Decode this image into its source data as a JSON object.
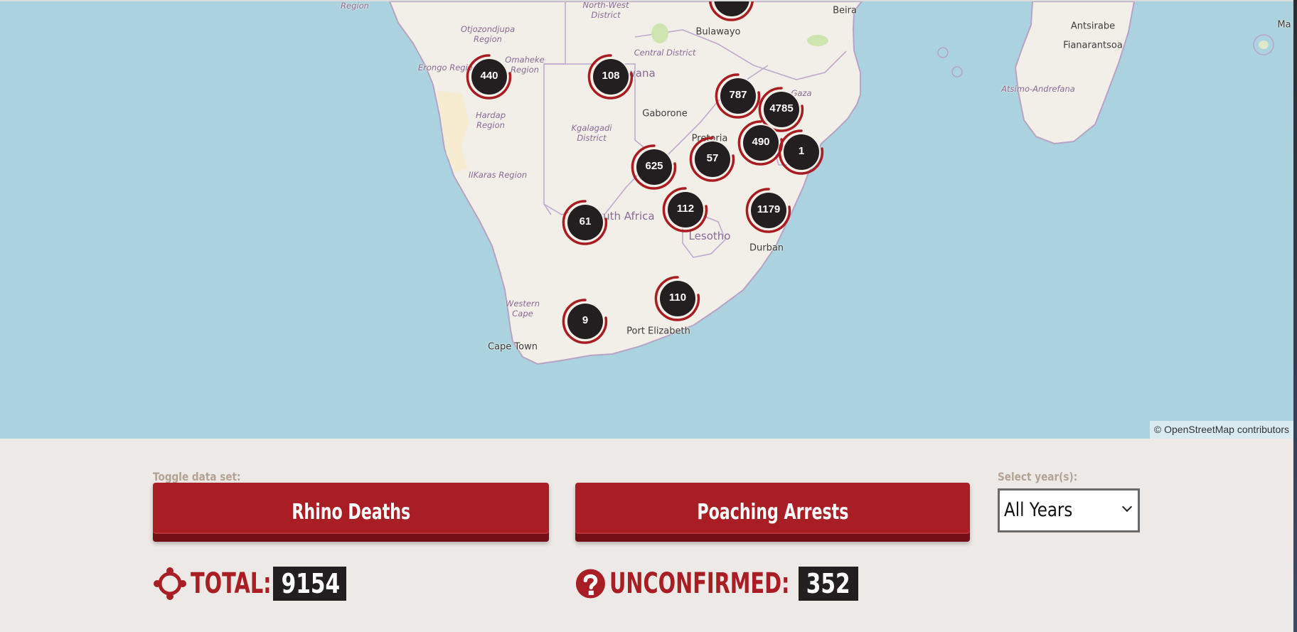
{
  "map": {
    "attribution": "© OpenStreetMap contributors",
    "colors": {
      "water": "#aad3df",
      "land": "#f2efe9",
      "border": "#b9a3c4",
      "marker_fill": "#231f20",
      "marker_ring": "#a81c22"
    },
    "labels": [
      {
        "text": "Region",
        "type": "region"
      },
      {
        "text": "Otjozondjupa\nRegion",
        "type": "region"
      },
      {
        "text": "Erongo Region",
        "type": "region"
      },
      {
        "text": "Omaheke\nRegion",
        "type": "region"
      },
      {
        "text": "Hardap\nRegion",
        "type": "region"
      },
      {
        "text": "IIKaras Region",
        "type": "region"
      },
      {
        "text": "North-West\nDistrict",
        "type": "region"
      },
      {
        "text": "Central District",
        "type": "region"
      },
      {
        "text": "Kgalagadi\nDistrict",
        "type": "region"
      },
      {
        "text": "Western\nCape",
        "type": "region"
      },
      {
        "text": "Gaza",
        "type": "region"
      },
      {
        "text": "Atsimo-Andrefana",
        "type": "region"
      },
      {
        "text": "Bulawayo",
        "type": "city"
      },
      {
        "text": "Beira",
        "type": "city"
      },
      {
        "text": "Gaborone",
        "type": "city"
      },
      {
        "text": "Pretoria",
        "type": "city"
      },
      {
        "text": "Durban",
        "type": "city"
      },
      {
        "text": "Port Elizabeth",
        "type": "city"
      },
      {
        "text": "Cape Town",
        "type": "city"
      },
      {
        "text": "Antsirabe",
        "type": "city"
      },
      {
        "text": "Fianarantsoa",
        "type": "city"
      },
      {
        "text": "Ma",
        "type": "city"
      },
      {
        "text": "Botswana",
        "type": "country"
      },
      {
        "text": "South Africa",
        "type": "country"
      },
      {
        "text": "Lesotho",
        "type": "country"
      }
    ],
    "clusters": [
      {
        "count": "440"
      },
      {
        "count": "108"
      },
      {
        "count": "787"
      },
      {
        "count": "4785"
      },
      {
        "count": "490"
      },
      {
        "count": "1"
      },
      {
        "count": "57"
      },
      {
        "count": "625"
      },
      {
        "count": "61"
      },
      {
        "count": "112"
      },
      {
        "count": "1179"
      },
      {
        "count": "110"
      },
      {
        "count": "9"
      },
      {
        "count": ""
      }
    ]
  },
  "controls": {
    "toggle_label": "Toggle data set:",
    "buttons": [
      {
        "label": "Rhino Deaths"
      },
      {
        "label": "Poaching Arrests"
      }
    ],
    "year_label": "Select year(s):",
    "year_selected": "All Years"
  },
  "stats": {
    "total_label": "TOTAL:",
    "total_value": "9154",
    "unconfirmed_label": "UNCONFIRMED:",
    "unconfirmed_value": "352"
  },
  "colors": {
    "accent": "#a91e24",
    "accent_dark": "#710f14",
    "background": "#ede9e6",
    "number_box": "#231f20",
    "muted_label": "#b3a395"
  }
}
